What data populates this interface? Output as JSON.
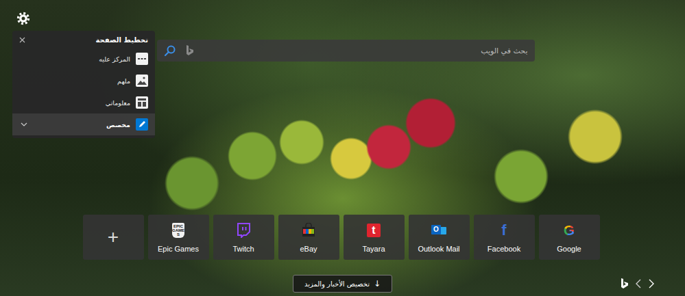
{
  "layout_panel": {
    "title": "تخطيط الصفحة",
    "items": [
      {
        "label": "المركز عليه",
        "kind": "focused",
        "selected": false
      },
      {
        "label": "ملهم",
        "kind": "inspirational",
        "selected": false
      },
      {
        "label": "معلوماتي",
        "kind": "informational",
        "selected": false
      },
      {
        "label": "مخصص",
        "kind": "custom",
        "selected": true
      }
    ]
  },
  "search": {
    "placeholder": "بحث في الويب"
  },
  "quick_links": [
    {
      "kind": "add",
      "label": "+",
      "logo": ""
    },
    {
      "kind": "site",
      "label": "Epic Games",
      "logo": "EPIC GAMES"
    },
    {
      "kind": "site",
      "label": "Twitch",
      "logo": ""
    },
    {
      "kind": "site",
      "label": "eBay",
      "logo": ""
    },
    {
      "kind": "site",
      "label": "Tayara",
      "logo": "t"
    },
    {
      "kind": "site",
      "label": "Outlook Mail",
      "logo": "O"
    },
    {
      "kind": "site",
      "label": "Facebook",
      "logo": "f"
    },
    {
      "kind": "site",
      "label": "Google",
      "logo": "G"
    }
  ],
  "news_button": {
    "label": "تخصيص الأخبار والمزيد",
    "icon": "↓"
  }
}
